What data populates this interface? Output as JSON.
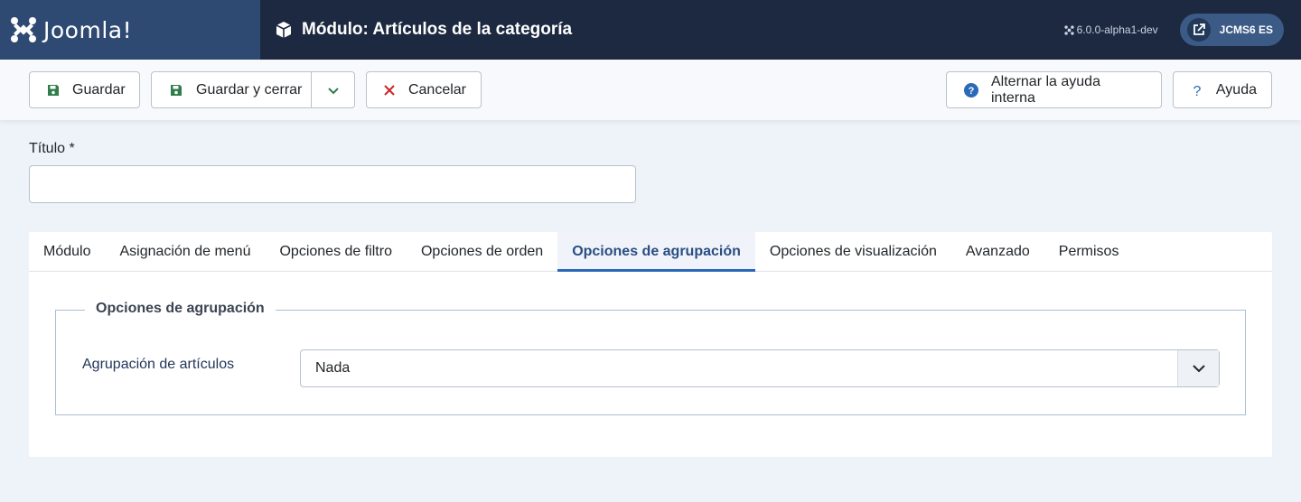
{
  "header": {
    "logo_text": "Joomla!",
    "title": "Módulo: Artículos de la categoría",
    "version": "6.0.0-alpha1-dev",
    "site_button": "JCMS6 ES",
    "icons": {
      "title": "cube-icon",
      "version": "joomla-icon",
      "site": "external-link-icon"
    }
  },
  "toolbar": {
    "save_label": "Guardar",
    "save_close_label": "Guardar y cerrar",
    "cancel_label": "Cancelar",
    "toggle_help_label": "Alternar la ayuda interna",
    "help_label": "Ayuda"
  },
  "form": {
    "title_label": "Título *",
    "title_value": ""
  },
  "tabs": [
    {
      "label": "Módulo",
      "active": false
    },
    {
      "label": "Asignación de menú",
      "active": false
    },
    {
      "label": "Opciones de filtro",
      "active": false
    },
    {
      "label": "Opciones de orden",
      "active": false
    },
    {
      "label": "Opciones de agrupación",
      "active": true
    },
    {
      "label": "Opciones de visualización",
      "active": false
    },
    {
      "label": "Avanzado",
      "active": false
    },
    {
      "label": "Permisos",
      "active": false
    }
  ],
  "panel": {
    "legend": "Opciones de agrupación",
    "field_label": "Agrupación de artículos",
    "select_value": "Nada"
  },
  "colors": {
    "header_bg": "#1c2940",
    "logo_bg": "#2f4a72",
    "accent": "#2a69b8",
    "save_icon": "#2f7d4a",
    "cancel_icon": "#c52827",
    "help_icon": "#2a69b8"
  }
}
